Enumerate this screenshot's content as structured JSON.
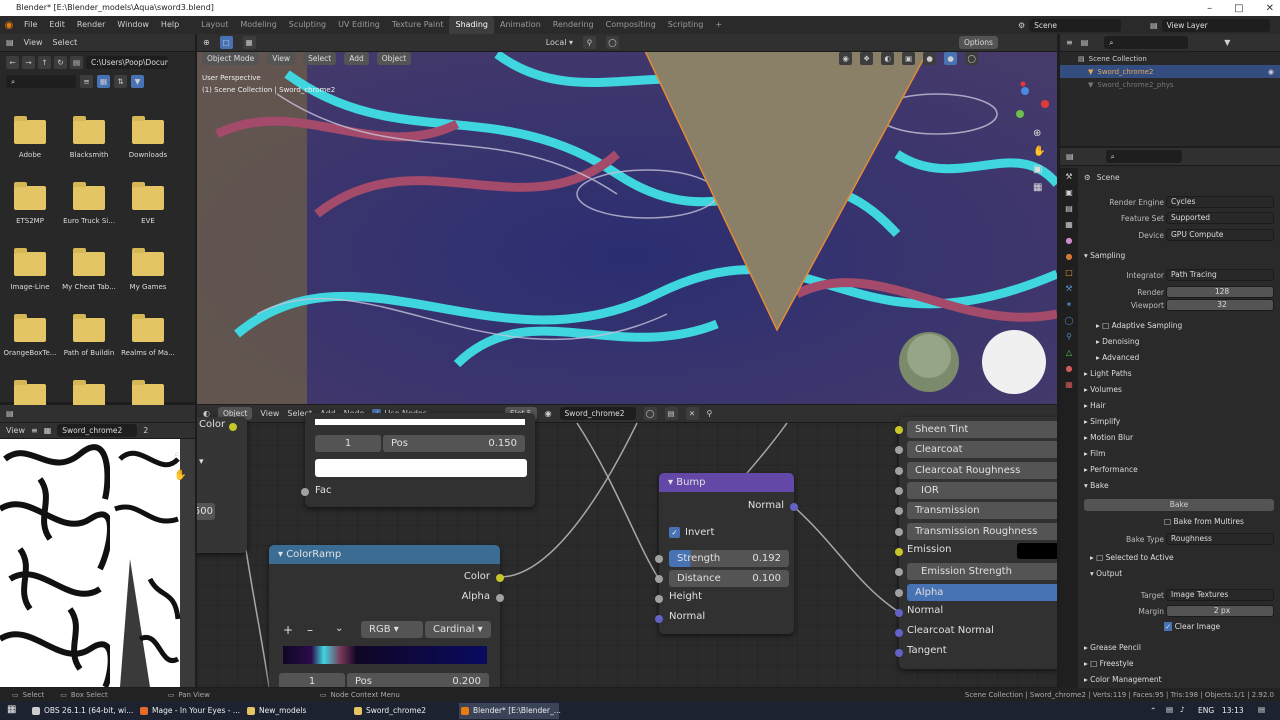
{
  "window": {
    "title": "Blender* [E:\\Blender_models\\Aqua\\sword3.blend]"
  },
  "menu": [
    "File",
    "Edit",
    "Render",
    "Window",
    "Help"
  ],
  "workspaces": [
    "Layout",
    "Modeling",
    "Sculpting",
    "UV Editing",
    "Texture Paint",
    "Shading",
    "Animation",
    "Rendering",
    "Compositing",
    "Scripting"
  ],
  "active_workspace": "Shading",
  "top_right": {
    "scene": "Scene",
    "view_layer": "View Layer"
  },
  "file_browser": {
    "menus": [
      "View",
      "Select"
    ],
    "path": "C:\\Users\\Poop\\Docum...",
    "folders": [
      "Adobe",
      "Blacksmith",
      "Downloads",
      "ETS2MP",
      "Euro Truck Si...",
      "EVE",
      "Image-Line",
      "My Cheat Tab...",
      "My Games",
      "OrangeBoxTe...",
      "Path of Buildin",
      "Realms of Ma...",
      "",
      "",
      ""
    ]
  },
  "viewport": {
    "mode": "Object Mode",
    "menus": [
      "View",
      "Select",
      "Add",
      "Object"
    ],
    "overlay_line1": "User Perspective",
    "overlay_line2": "(1) Scene Collection | Sword_chrome2",
    "transform": "Local",
    "options": "Options"
  },
  "node_editor": {
    "type": "Object",
    "menus": [
      "View",
      "Select",
      "Add",
      "Node"
    ],
    "use_nodes": "Use Nodes",
    "slot": "Slot 5",
    "material": "Sword_chrome2",
    "top_node": {
      "color_label": "Color",
      "index": "1",
      "pos_label": "Pos",
      "pos_value": "0.150",
      "fac": "Fac",
      "val500": "500"
    },
    "colorramp": {
      "title": "ColorRamp",
      "out_color": "Color",
      "out_alpha": "Alpha",
      "mode": "RGB",
      "interp": "Cardinal",
      "index": "1",
      "pos_label": "Pos",
      "pos_value": "0.200"
    },
    "bump": {
      "title": "Bump",
      "normal_out": "Normal",
      "invert": "Invert",
      "strength_label": "Strength",
      "strength": "0.192",
      "distance_label": "Distance",
      "distance": "0.100",
      "height": "Height",
      "normal_in": "Normal"
    },
    "bsdf_inputs": [
      "Sheen Tint",
      "Clearcoat",
      "Clearcoat Roughness",
      "IOR",
      "Transmission",
      "Transmission Roughness",
      "Emission",
      "Emission Strength",
      "Alpha",
      "Normal",
      "Clearcoat Normal",
      "Tangent"
    ]
  },
  "image_editor": {
    "menus": [
      "View"
    ],
    "image": "Sword_chrome2",
    "users": "2"
  },
  "outliner": {
    "root": "Scene Collection",
    "items": [
      "Sword_chrome2",
      "Sword_chrome2_phys"
    ]
  },
  "properties": {
    "scene": "Scene",
    "render_engine_label": "Render Engine",
    "render_engine": "Cycles",
    "feature_set_label": "Feature Set",
    "feature_set": "Supported",
    "device_label": "Device",
    "device": "GPU Compute",
    "sampling": "Sampling",
    "integrator_label": "Integrator",
    "integrator": "Path Tracing",
    "render_label": "Render",
    "render": "128",
    "viewport_label": "Viewport",
    "viewport": "32",
    "sub_sampling": [
      "Adaptive Sampling",
      "Denoising",
      "Advanced"
    ],
    "sections": [
      "Light Paths",
      "Volumes",
      "Hair",
      "Simplify",
      "Motion Blur",
      "Film",
      "Performance",
      "Bake"
    ],
    "bake_button": "Bake",
    "bake_from_multires": "Bake from Multires",
    "bake_type_label": "Bake Type",
    "bake_type": "Roughness",
    "selected_to_active": "Selected to Active",
    "output": "Output",
    "target_label": "Target",
    "target": "Image Textures",
    "margin_label": "Margin",
    "margin": "2 px",
    "clear_image": "Clear Image",
    "bottom_sections": [
      "Grease Pencil",
      "Freestyle",
      "Color Management"
    ]
  },
  "status": {
    "select": "Select",
    "box_select": "Box Select",
    "pan_view": "Pan View",
    "node_context": "Node Context Menu",
    "info": "Scene Collection | Sword_chrome2 | Verts:119 | Faces:95 | Tris:198 | Objects:1/1 | 2.92.0"
  },
  "taskbar": {
    "items": [
      "OBS 26.1.1 (64-bit, wi...",
      "Mage - In Your Eyes - ...",
      "New_models",
      "Sword_chrome2",
      "Blender* [E:\\Blender_..."
    ],
    "lang": "ENG",
    "time": "13:13"
  }
}
